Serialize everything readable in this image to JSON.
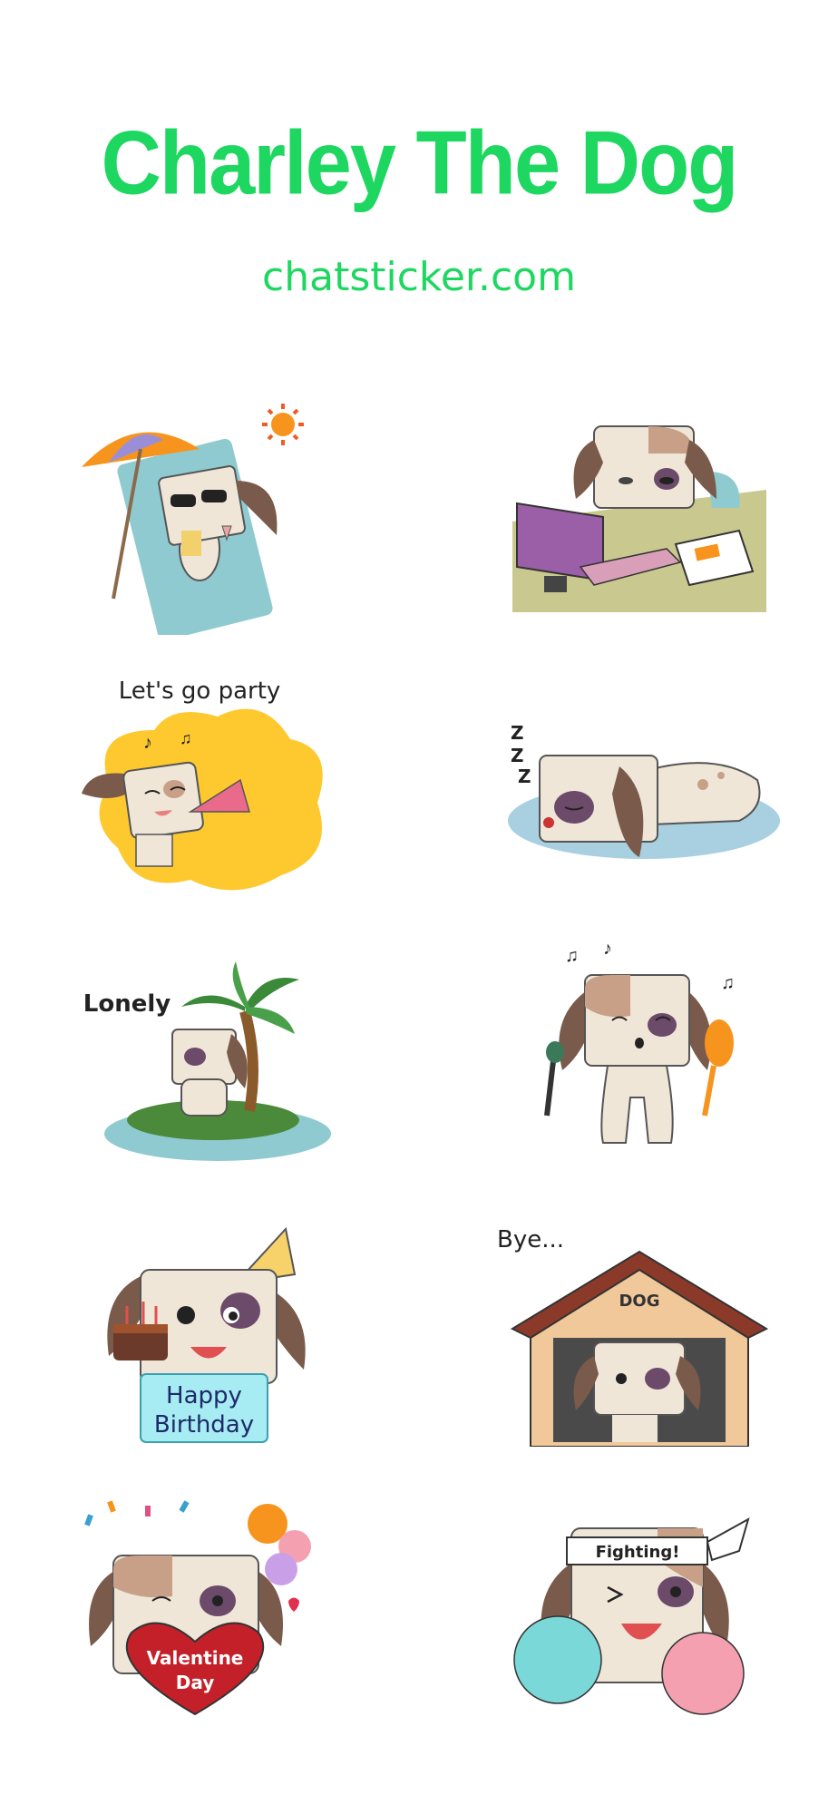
{
  "page": {
    "title": "Charley The Dog",
    "subtitle": "chatsticker.com"
  },
  "stickers": [
    {
      "name": "beach-sunbathing",
      "caption": ""
    },
    {
      "name": "office-tired",
      "caption": ""
    },
    {
      "name": "party",
      "caption": "Let's go party"
    },
    {
      "name": "sleeping",
      "caption": "",
      "sound": "zzzz"
    },
    {
      "name": "lonely-island",
      "caption": "Lonely"
    },
    {
      "name": "singing-maracas",
      "caption": ""
    },
    {
      "name": "happy-birthday",
      "caption": "",
      "sign_line1": "Happy",
      "sign_line2": "Birthday"
    },
    {
      "name": "doghouse-bye",
      "caption": "Bye...",
      "house_sign": "DOG"
    },
    {
      "name": "valentine",
      "caption": "",
      "heart_line1": "Valentine",
      "heart_line2": "Day"
    },
    {
      "name": "fighting-cheer",
      "caption": "",
      "headband": "Fighting!"
    }
  ],
  "colors": {
    "accent": "#1ed760",
    "dog_fur": "#efe6d8",
    "dog_patch": "#c8a088",
    "dog_ear": "#7a5a4a",
    "eye_patch": "#6b4a6a"
  }
}
